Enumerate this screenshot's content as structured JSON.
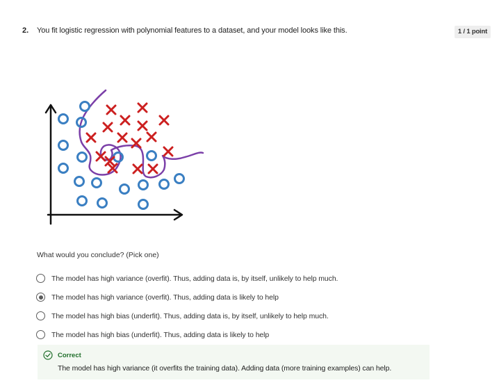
{
  "question": {
    "number": "2.",
    "text": "You fit logistic regression with polynomial features to a dataset, and your model looks like this.",
    "points": "1 / 1 point"
  },
  "figure": {
    "o_color": "#3a7fc2",
    "x_color": "#cc1f1f",
    "boundary_color": "#7b3fa8",
    "axis_color": "#111111"
  },
  "prompt": "What would you conclude? (Pick one)",
  "options": [
    {
      "label": "The model has high variance (overfit). Thus, adding data is, by itself, unlikely to help much.",
      "selected": false
    },
    {
      "label": "The model has high variance (overfit). Thus, adding data is likely to help",
      "selected": true
    },
    {
      "label": "The model has high bias (underfit). Thus, adding data is, by itself, unlikely to help much.",
      "selected": false
    },
    {
      "label": "The model has high bias (underfit). Thus, adding data is likely to help",
      "selected": false
    }
  ],
  "feedback": {
    "status": "Correct",
    "text": "The model has high variance (it overfits the training data). Adding data (more training examples) can help.",
    "color": "#1f6e2a",
    "background": "#f3f8f2"
  }
}
